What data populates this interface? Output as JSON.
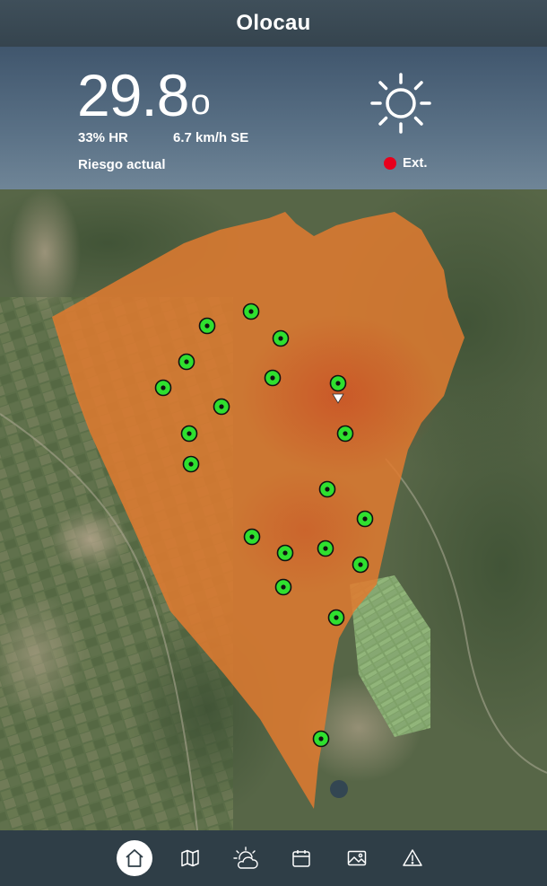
{
  "header": {
    "title": "Olocau"
  },
  "weather": {
    "temperature": "29.8",
    "degree_symbol": "o",
    "humidity": "33% HR",
    "wind": "6.7 km/h SE",
    "risk_label": "Riesgo actual",
    "risk_level": "Ext.",
    "risk_color": "#e8001c",
    "condition_icon": "sun-icon"
  },
  "map": {
    "zone_color": "#e07a30",
    "marker_color": "#2fe02f",
    "markers_count_shown": true
  },
  "nav": {
    "items": [
      {
        "name": "home",
        "icon": "home-icon",
        "active": true
      },
      {
        "name": "map",
        "icon": "map-icon",
        "active": false
      },
      {
        "name": "forecast",
        "icon": "weather-icon",
        "active": false
      },
      {
        "name": "calendar",
        "icon": "calendar-icon",
        "active": false
      },
      {
        "name": "gallery",
        "icon": "image-icon",
        "active": false
      },
      {
        "name": "alerts",
        "icon": "warning-icon",
        "active": false
      }
    ]
  }
}
